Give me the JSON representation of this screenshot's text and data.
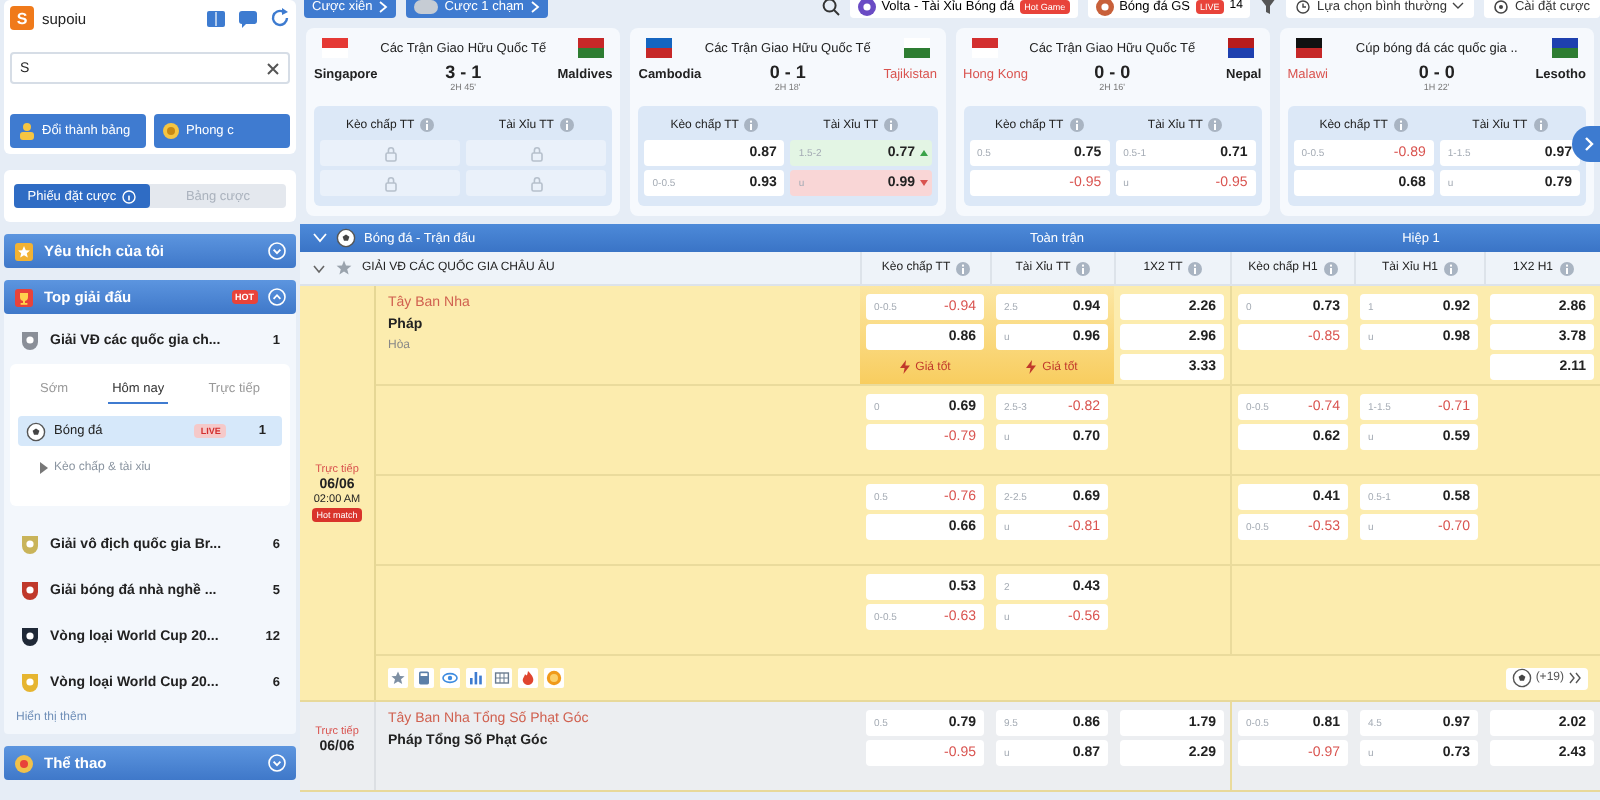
{
  "topbar": {
    "parlay": "Cược xiên",
    "one_click": {
      "label": "Cược 1 chạm",
      "on": false
    },
    "games": [
      {
        "label": "Volta - Tài Xỉu Bóng đá",
        "badge": "Hot Game"
      },
      {
        "label": "Bóng đá GS",
        "badge": "LIVE",
        "count": "14"
      }
    ],
    "odds_view": "Lựa chọn bình thường",
    "settings": "Cài đặt cược"
  },
  "sidebar": {
    "user": {
      "avatar": "S",
      "name": "supoiu"
    },
    "search": {
      "value": "S"
    },
    "buttons": [
      "Đổi thành bảng",
      "Phong c"
    ],
    "tabs": [
      {
        "label": "Phiếu đặt cược",
        "selected": true
      },
      {
        "label": "Bảng cược",
        "selected": false
      }
    ],
    "favorites": {
      "title": "Yêu thích của tôi",
      "expanded": false
    },
    "top": {
      "title": "Top giải đấu",
      "badge": "HOT",
      "expanded": true,
      "leagues": [
        {
          "name": "Giải VĐ các quốc gia ch...",
          "count": "1",
          "expanded": true,
          "filters": [
            {
              "label": "Sớm",
              "selected": false
            },
            {
              "label": "Hôm nay",
              "selected": true
            },
            {
              "label": "Trực tiếp",
              "selected": false
            }
          ],
          "sports": [
            {
              "name": "Bóng đá",
              "badge": "LIVE",
              "count": "1",
              "selected": true,
              "children": [
                {
                  "name": "Kèo chấp & tài xỉu",
                  "expanded": false
                }
              ]
            }
          ]
        },
        {
          "name": "Giải vô địch quốc gia Br...",
          "count": "6"
        },
        {
          "name": "Giải bóng đá nhà nghề ...",
          "count": "5"
        },
        {
          "name": "Vòng loại World Cup 20...",
          "count": "12"
        },
        {
          "name": "Vòng loại World Cup 20...",
          "count": "6"
        }
      ],
      "more": "Hiển thị thêm"
    },
    "sports": {
      "title": "Thể thao",
      "expanded": false
    }
  },
  "live_cards": [
    {
      "league": "Các Trận Giao Hữu Quốc Tế",
      "home": {
        "name": "Singapore",
        "highlight": false
      },
      "away": {
        "name": "Maldives",
        "highlight": false
      },
      "score": "3 - 1",
      "time": "2H 45'",
      "markets": [
        {
          "title": "Kèo chấp TT",
          "cells": [
            {
              "locked": true
            },
            {
              "locked": true
            }
          ]
        },
        {
          "title": "Tài Xỉu TT",
          "cells": [
            {
              "locked": true
            },
            {
              "locked": true
            }
          ]
        }
      ]
    },
    {
      "league": "Các Trận Giao Hữu Quốc Tế",
      "home": {
        "name": "Cambodia",
        "highlight": false
      },
      "away": {
        "name": "Tajikistan",
        "highlight": true
      },
      "score": "0 - 1",
      "time": "2H 18'",
      "markets": [
        {
          "title": "Kèo chấp TT",
          "cells": [
            {
              "locked": false,
              "odds": "0.87",
              "negative": false
            },
            {
              "locked": false,
              "line": "0-0.5",
              "odds": "0.93",
              "negative": false
            }
          ]
        },
        {
          "title": "Tài Xỉu TT",
          "cells": [
            {
              "locked": false,
              "line": "1.5-2",
              "odds": "0.77",
              "negative": false,
              "rising": true,
              "falling": false
            },
            {
              "locked": false,
              "line": "u",
              "odds": "0.99",
              "negative": false,
              "rising": false,
              "falling": true
            }
          ]
        }
      ]
    },
    {
      "league": "Các Trận Giao Hữu Quốc Tế",
      "home": {
        "name": "Hong Kong",
        "highlight": true
      },
      "away": {
        "name": "Nepal",
        "highlight": false
      },
      "score": "0 - 0",
      "time": "2H 16'",
      "markets": [
        {
          "title": "Kèo chấp TT",
          "cells": [
            {
              "locked": false,
              "line": "0.5",
              "odds": "0.75",
              "negative": false
            },
            {
              "locked": false,
              "odds": "-0.95",
              "negative": true
            }
          ]
        },
        {
          "title": "Tài Xỉu TT",
          "cells": [
            {
              "locked": false,
              "line": "0.5-1",
              "odds": "0.71",
              "negative": false
            },
            {
              "locked": false,
              "line": "u",
              "odds": "-0.95",
              "negative": true
            }
          ]
        }
      ]
    },
    {
      "league": "Cúp bóng đá các quốc gia ..",
      "home": {
        "name": "Malawi",
        "highlight": true
      },
      "away": {
        "name": "Lesotho",
        "highlight": false
      },
      "score": "0 - 0",
      "time": "1H 22'",
      "markets": [
        {
          "title": "Kèo chấp TT",
          "cells": [
            {
              "locked": false,
              "line": "0-0.5",
              "odds": "-0.89",
              "negative": true
            },
            {
              "locked": false,
              "odds": "0.68",
              "negative": false
            }
          ]
        },
        {
          "title": "Tài Xỉu TT",
          "cells": [
            {
              "locked": false,
              "line": "1-1.5",
              "odds": "0.97",
              "negative": false
            },
            {
              "locked": false,
              "line": "u",
              "odds": "0.79",
              "negative": false
            }
          ]
        }
      ]
    }
  ],
  "section": {
    "title": "Bóng đá - Trận đấu",
    "expanded": true,
    "periods": [
      "Toàn trận",
      "Hiệp 1"
    ]
  },
  "league": {
    "name": "GIẢI VĐ CÁC QUỐC GIA CHÂU ÂU",
    "expanded": true,
    "columns": [
      "Kèo chấp TT",
      "Tài Xỉu TT",
      "1X2 TT",
      "Kèo chấp H1",
      "Tài Xỉu H1",
      "1X2 H1"
    ]
  },
  "matches": [
    {
      "status": "Trực tiếp",
      "date": "06/06",
      "time": "02:00 AM",
      "badge": "Hot match",
      "home": "Tây Ban Nha",
      "away": "Pháp",
      "draw": "Hòa",
      "more": "(+19)",
      "rows": [
        {
          "handicap_ft": {
            "best": true,
            "label": "Giá tốt",
            "cells": [
              {
                "line": "0-0.5",
                "odds": "-0.94",
                "negative": true
              },
              {
                "odds": "0.86",
                "negative": false
              }
            ]
          },
          "ou_ft": {
            "best": true,
            "label": "Giá tốt",
            "cells": [
              {
                "line": "2.5",
                "odds": "0.94",
                "negative": false
              },
              {
                "line": "u",
                "odds": "0.96",
                "negative": false
              }
            ]
          },
          "x12_ft": {
            "cells": [
              {
                "odds": "2.26",
                "negative": false
              },
              {
                "odds": "2.96",
                "negative": false
              },
              {
                "odds": "3.33",
                "negative": false
              }
            ]
          },
          "handicap_h1": {
            "cells": [
              {
                "line": "0",
                "odds": "0.73",
                "negative": false
              },
              {
                "odds": "-0.85",
                "negative": true
              }
            ]
          },
          "ou_h1": {
            "cells": [
              {
                "line": "1",
                "odds": "0.92",
                "negative": false
              },
              {
                "line": "u",
                "odds": "0.98",
                "negative": false
              }
            ]
          },
          "x12_h1": {
            "cells": [
              {
                "odds": "2.86",
                "negative": false
              },
              {
                "odds": "3.78",
                "negative": false
              },
              {
                "odds": "2.11",
                "negative": false
              }
            ]
          }
        },
        {
          "handicap_ft": {
            "cells": [
              {
                "line": "0",
                "odds": "0.69",
                "negative": false
              },
              {
                "odds": "-0.79",
                "negative": true
              }
            ]
          },
          "ou_ft": {
            "cells": [
              {
                "line": "2.5-3",
                "odds": "-0.82",
                "negative": true
              },
              {
                "line": "u",
                "odds": "0.70",
                "negative": false
              }
            ]
          },
          "handicap_h1": {
            "cells": [
              {
                "line": "0-0.5",
                "odds": "-0.74",
                "negative": true
              },
              {
                "odds": "0.62",
                "negative": false
              }
            ]
          },
          "ou_h1": {
            "cells": [
              {
                "line": "1-1.5",
                "odds": "-0.71",
                "negative": true
              },
              {
                "line": "u",
                "odds": "0.59",
                "negative": false
              }
            ]
          }
        },
        {
          "handicap_ft": {
            "cells": [
              {
                "line": "0.5",
                "odds": "-0.76",
                "negative": true
              },
              {
                "odds": "0.66",
                "negative": false
              }
            ]
          },
          "ou_ft": {
            "cells": [
              {
                "line": "2-2.5",
                "odds": "0.69",
                "negative": false
              },
              {
                "line": "u",
                "odds": "-0.81",
                "negative": true
              }
            ]
          },
          "handicap_h1": {
            "cells": [
              {
                "odds": "0.41",
                "negative": false
              },
              {
                "line": "0-0.5",
                "odds": "-0.53",
                "negative": true
              }
            ]
          },
          "ou_h1": {
            "cells": [
              {
                "line": "0.5-1",
                "odds": "0.58",
                "negative": false
              },
              {
                "line": "u",
                "odds": "-0.70",
                "negative": true
              }
            ]
          }
        },
        {
          "handicap_ft": {
            "cells": [
              {
                "odds": "0.53",
                "negative": false
              },
              {
                "line": "0-0.5",
                "odds": "-0.63",
                "negative": true
              }
            ]
          },
          "ou_ft": {
            "cells": [
              {
                "line": "2",
                "odds": "0.43",
                "negative": false
              },
              {
                "line": "u",
                "odds": "-0.56",
                "negative": true
              }
            ]
          }
        }
      ]
    },
    {
      "status": "Trực tiếp",
      "date": "06/06",
      "home": "Tây Ban Nha Tổng Số Phạt Góc",
      "away": "Pháp Tổng Số Phạt Góc",
      "rows": [
        {
          "handicap_ft": {
            "cells": [
              {
                "line": "0.5",
                "odds": "0.79",
                "negative": false
              },
              {
                "odds": "-0.95",
                "negative": true
              }
            ]
          },
          "ou_ft": {
            "cells": [
              {
                "line": "9.5",
                "odds": "0.86",
                "negative": false
              },
              {
                "line": "u",
                "odds": "0.87",
                "negative": false
              }
            ]
          },
          "x12_ft": {
            "cells": [
              {
                "odds": "1.79",
                "negative": false
              },
              {
                "odds": "2.29",
                "negative": false
              }
            ]
          },
          "handicap_h1": {
            "cells": [
              {
                "line": "0-0.5",
                "odds": "0.81",
                "negative": false
              },
              {
                "odds": "-0.97",
                "negative": true
              }
            ]
          },
          "ou_h1": {
            "cells": [
              {
                "line": "4.5",
                "odds": "0.97",
                "negative": false
              },
              {
                "line": "u",
                "odds": "0.73",
                "negative": false
              }
            ]
          },
          "x12_h1": {
            "cells": [
              {
                "odds": "2.02",
                "negative": false
              },
              {
                "odds": "2.43",
                "negative": false
              }
            ]
          }
        }
      ]
    }
  ]
}
